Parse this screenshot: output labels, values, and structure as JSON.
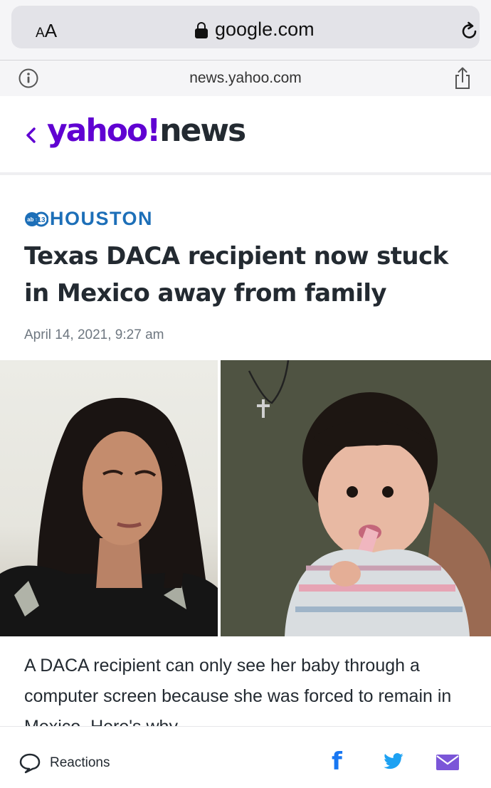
{
  "browser": {
    "text_size_button": "AA",
    "address": "google.com",
    "site_host": "news.yahoo.com",
    "icons": [
      "lock-icon",
      "reload-icon",
      "info-icon",
      "share-icon"
    ]
  },
  "header": {
    "logo_brand": "yahoo!",
    "logo_section": "news",
    "back_icon": "chevron-left-icon",
    "colors": {
      "brand_purple": "#6001d2",
      "dark": "#232a31"
    }
  },
  "article": {
    "source_name": "HOUSTON",
    "source_badge": "abc13",
    "headline": "Texas DACA recipient now stuck in Mexico away from family",
    "date": "April 14, 2021, 9:27 am",
    "image_left_desc": "woman on video call",
    "image_right_desc": "baby held by parent",
    "summary": "A DACA recipient can only see her baby through a computer screen because she was forced to remain in Mexico. Here's why."
  },
  "bottom_bar": {
    "reactions_label": "Reactions",
    "share_icons": [
      "facebook-icon",
      "twitter-icon",
      "mail-icon"
    ],
    "colors": {
      "facebook": "#1877f2",
      "twitter": "#1da1f2",
      "mail": "#7b56d8"
    }
  }
}
